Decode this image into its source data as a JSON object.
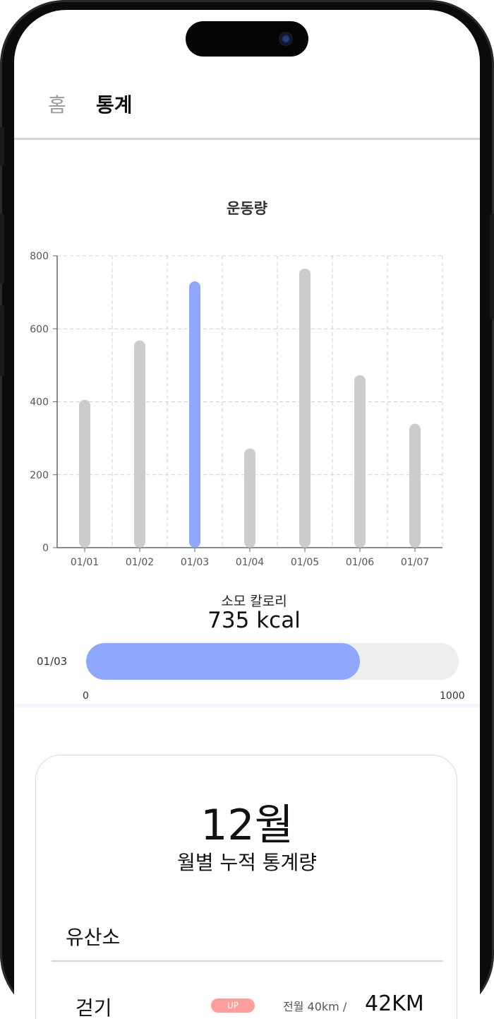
{
  "nav": {
    "tabs": [
      {
        "label": "홈",
        "active": false
      },
      {
        "label": "통계",
        "active": true
      }
    ]
  },
  "chart_title": "운동량",
  "chart_data": {
    "type": "bar",
    "categories": [
      "01/01",
      "01/02",
      "01/03",
      "01/04",
      "01/05",
      "01/06",
      "01/07"
    ],
    "values": [
      405,
      568,
      730,
      272,
      765,
      473,
      340
    ],
    "highlight_index": 2,
    "ylim": [
      0,
      800
    ],
    "yticks": [
      0,
      200,
      400,
      600,
      800
    ],
    "grid": true,
    "colors": {
      "bar": "#cccccc",
      "highlight": "#8ea7ff"
    }
  },
  "calories": {
    "label": "소모 칼로리",
    "value_text": "735 kcal",
    "date": "01/03",
    "value": 735,
    "min": 0,
    "max": 1000,
    "min_label": "0",
    "max_label": "1000",
    "fill_color": "#8ea7ff"
  },
  "monthly": {
    "month": "12월",
    "subtitle": "월별 누적 통계량",
    "place": "유산소",
    "row": {
      "label": "걷기",
      "badge": "UP",
      "prev": "전월 40km /",
      "value": "42KM"
    }
  }
}
